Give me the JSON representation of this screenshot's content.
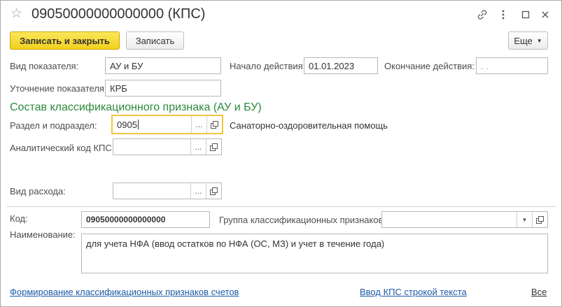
{
  "window": {
    "title": "09050000000000000 (КПС)"
  },
  "toolbar": {
    "save_close_label": "Записать и закрыть",
    "save_label": "Записать",
    "more_label": "Еще"
  },
  "fields": {
    "indicator_type": {
      "label": "Вид показателя:",
      "value": "АУ и БУ"
    },
    "start_date": {
      "label": "Начало действия:",
      "value": "01.01.2023"
    },
    "end_date": {
      "label": "Окончание действия:",
      "value": ". ."
    },
    "indicator_refinement": {
      "label": "Уточнение показателя:",
      "value": "КРБ"
    }
  },
  "section": {
    "title": "Состав классификационного признака (АУ и БУ)"
  },
  "classification": {
    "section_subsection": {
      "label": "Раздел и подраздел:",
      "value": "0905",
      "description": "Санаторно-оздоровительная помощь"
    },
    "analytic_code": {
      "label": "Аналитический код КПС:",
      "value": ""
    },
    "expense_type": {
      "label": "Вид расхода:",
      "value": ""
    }
  },
  "bottom": {
    "code": {
      "label": "Код:",
      "value": "09050000000000000"
    },
    "group": {
      "label": "Группа классификационных признаков:",
      "value": ""
    },
    "name": {
      "label": "Наименование:",
      "value": "для учета НФА (ввод остатков по НФА (ОС, МЗ) и учет в течение года)"
    }
  },
  "links": {
    "forming": "Формирование классификационных признаков счетов",
    "input_text": "Ввод КПС строкой текста",
    "all": "Все"
  },
  "icons": {
    "favorite": "star-outline",
    "link": "chain-link",
    "menu": "vertical-ellipsis",
    "maximize": "square",
    "close": "x"
  },
  "colors": {
    "primary_button": "#f2d11c",
    "section_title": "#2a8a3a",
    "link": "#1a5aa6",
    "focus_border": "#f2c53d"
  }
}
